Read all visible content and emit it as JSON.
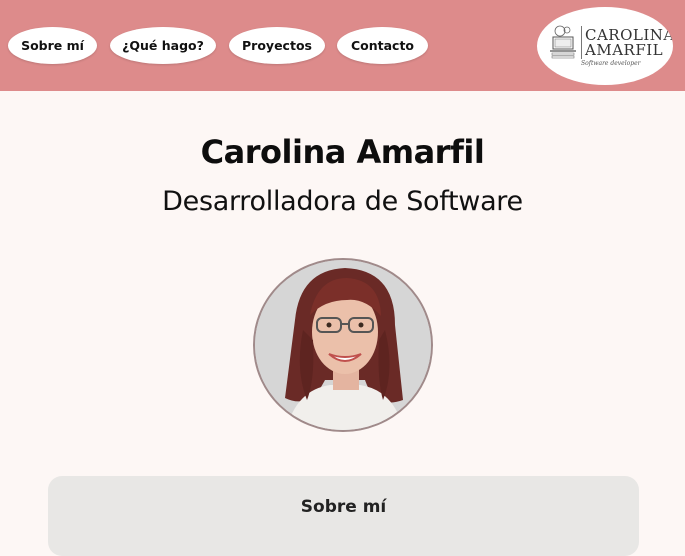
{
  "nav": {
    "items": [
      {
        "label": "Sobre mí"
      },
      {
        "label": "¿Qué hago?"
      },
      {
        "label": "Proyectos"
      },
      {
        "label": "Contacto"
      }
    ]
  },
  "logo": {
    "line1": "CAROLINA",
    "line2": "AMARFIL",
    "tagline": "Software developer"
  },
  "hero": {
    "name": "Carolina Amarfil",
    "role": "Desarrolladora de Software"
  },
  "about_card": {
    "title": "Sobre mí"
  },
  "colors": {
    "header_bg": "#dd8b8b",
    "page_bg": "#fdf7f5",
    "card_bg": "#e8e7e5"
  }
}
